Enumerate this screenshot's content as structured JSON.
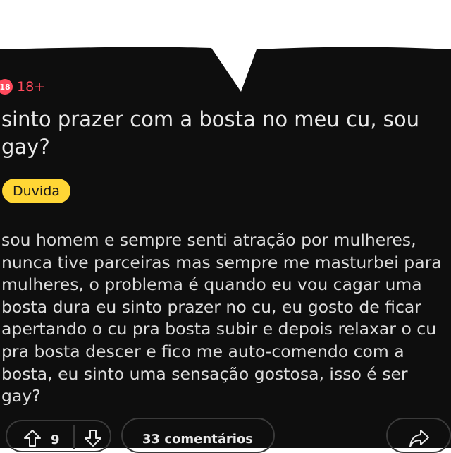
{
  "post": {
    "nsfw_badge": {
      "icon": "18-icon",
      "icon_text": "18",
      "label": "18+",
      "color": "#ff4a5c"
    },
    "title": "sinto prazer com a bosta no meu cu, sou gay?",
    "flair": {
      "label": "Duvida",
      "color": "#ffd635"
    },
    "body": "sou homem e sempre senti atração por mulheres, nunca tive parceiras mas sempre me masturbei para mulheres, o problema é quando eu vou cagar uma bosta dura eu sinto prazer no cu, eu gosto de ficar apertando o cu pra bosta subir e depois relaxar o cu pra bosta descer e fico me auto-comendo com a bosta, eu sinto uma sensação gostosa, isso é ser gay?"
  },
  "actions": {
    "upvote_icon": "arrow-up-icon",
    "vote_count": "9",
    "downvote_icon": "arrow-down-icon",
    "comments_label": "33 comentários",
    "share_icon": "share-icon"
  },
  "theme": {
    "background": "#0e0e0e",
    "text": "#e9e9e9"
  }
}
